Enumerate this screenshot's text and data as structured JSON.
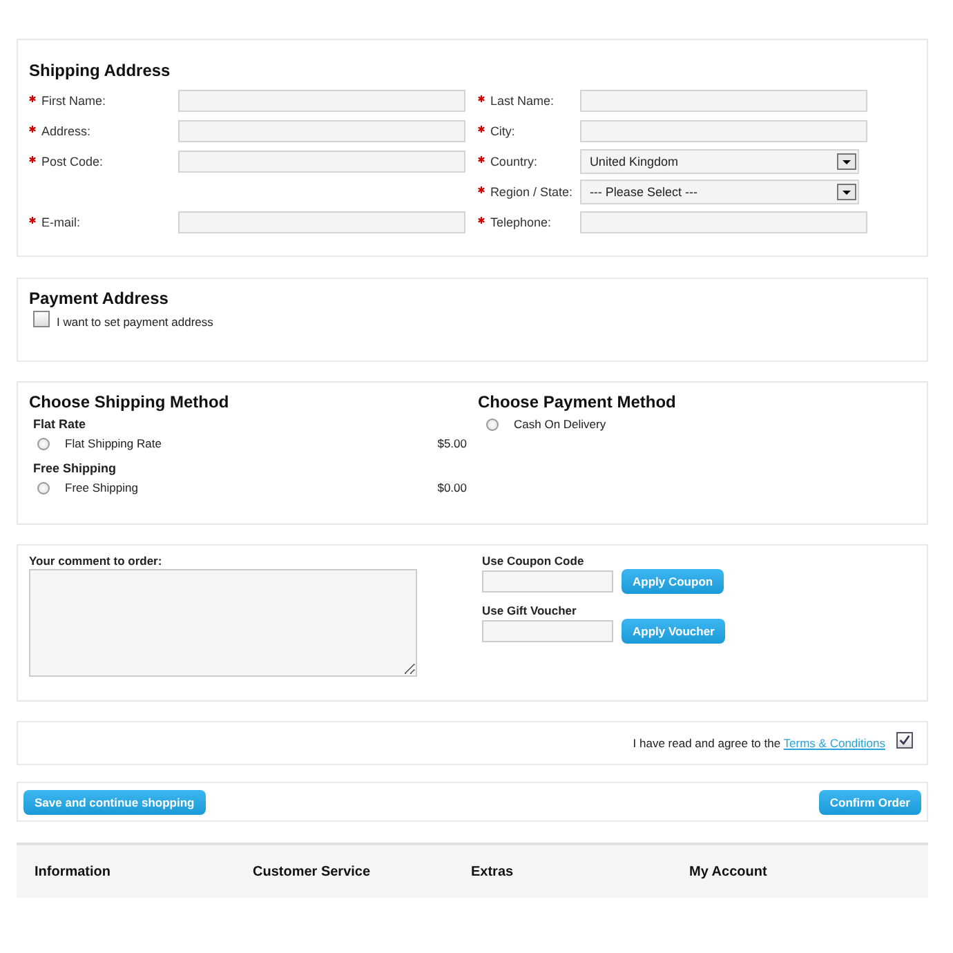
{
  "shipping_address": {
    "title": "Shipping Address",
    "rows": [
      {
        "left": {
          "label": "First Name:",
          "required": true,
          "kind": "text"
        },
        "right": {
          "label": "Last Name:",
          "required": true,
          "kind": "text"
        }
      },
      {
        "left": {
          "label": "Address:",
          "required": true,
          "kind": "text"
        },
        "right": {
          "label": "City:",
          "required": true,
          "kind": "text"
        }
      },
      {
        "left": {
          "label": "Post Code:",
          "required": true,
          "kind": "text"
        },
        "right": {
          "label": "Country:",
          "required": true,
          "kind": "select",
          "value": "United Kingdom"
        }
      },
      {
        "right": {
          "label": "Region / State:",
          "required": true,
          "kind": "select",
          "value": "--- Please Select ---"
        }
      },
      {
        "left": {
          "label": "E-mail:",
          "required": true,
          "kind": "text"
        },
        "right": {
          "label": "Telephone:",
          "required": true,
          "kind": "text"
        }
      }
    ]
  },
  "payment_address": {
    "title": "Payment Address",
    "checkbox": {
      "label": "I want to set payment address",
      "checked": false
    }
  },
  "shipping_method": {
    "title": "Choose Shipping Method",
    "groups": [
      {
        "title": "Flat Rate",
        "options": [
          {
            "label": "Flat Shipping Rate",
            "price": "$5.00",
            "selected": false
          }
        ]
      },
      {
        "title": "Free Shipping",
        "options": [
          {
            "label": "Free Shipping",
            "price": "$0.00",
            "selected": false
          }
        ]
      }
    ]
  },
  "payment_method": {
    "title": "Choose Payment Method",
    "options": [
      {
        "label": "Cash On Delivery",
        "selected": false
      }
    ]
  },
  "comment": {
    "label": "Your comment to order:"
  },
  "coupon": {
    "label": "Use Coupon Code",
    "button": "Apply Coupon"
  },
  "voucher": {
    "label": "Use Gift Voucher",
    "button": "Apply Voucher"
  },
  "terms": {
    "text": "I have read and agree to the",
    "link": "Terms & Conditions",
    "checked": true
  },
  "buttons": {
    "continue": "Save and continue shopping",
    "confirm": "Confirm Order"
  },
  "footer": {
    "columns": [
      "Information",
      "Customer Service",
      "Extras",
      "My Account"
    ]
  }
}
